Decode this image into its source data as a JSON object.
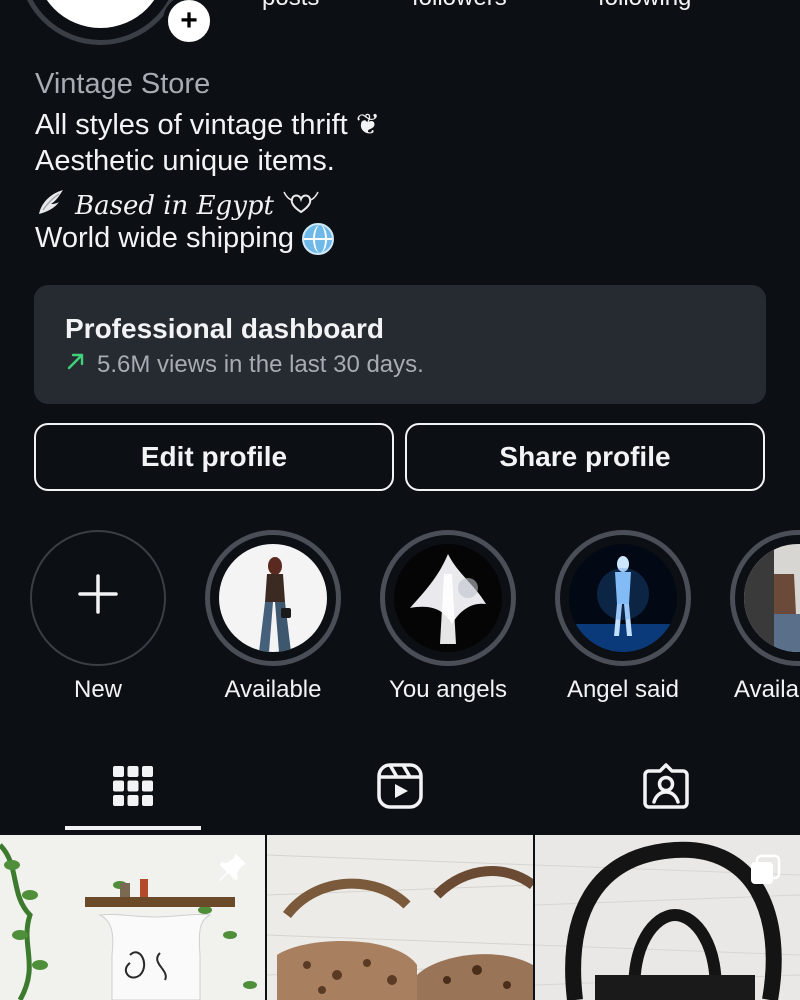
{
  "header": {
    "stats": [
      "posts",
      "followers",
      "following"
    ]
  },
  "bio": {
    "name": "Vintage Store",
    "line1": "All styles of vintage thrift ❦",
    "line2": "Aesthetic unique items.",
    "line3": "Based in Egypt",
    "line4": "World wide shipping"
  },
  "dashboard": {
    "title": "Professional dashboard",
    "subtitle": "5.6M views in the last 30 days."
  },
  "buttons": {
    "edit": "Edit profile",
    "share": "Share profile"
  },
  "highlights": [
    {
      "label": "New"
    },
    {
      "label": "Available"
    },
    {
      "label": "You angels"
    },
    {
      "label": "Angel said"
    },
    {
      "label": "Availa"
    }
  ],
  "tabs": [
    {
      "icon": "grid-icon",
      "active": true
    },
    {
      "icon": "reels-icon",
      "active": false
    },
    {
      "icon": "tagged-icon",
      "active": false
    }
  ],
  "colors": {
    "background": "#0c0f14",
    "card": "#262a31",
    "accent_green": "#3fd27a",
    "muted_text": "#a8abb2"
  }
}
